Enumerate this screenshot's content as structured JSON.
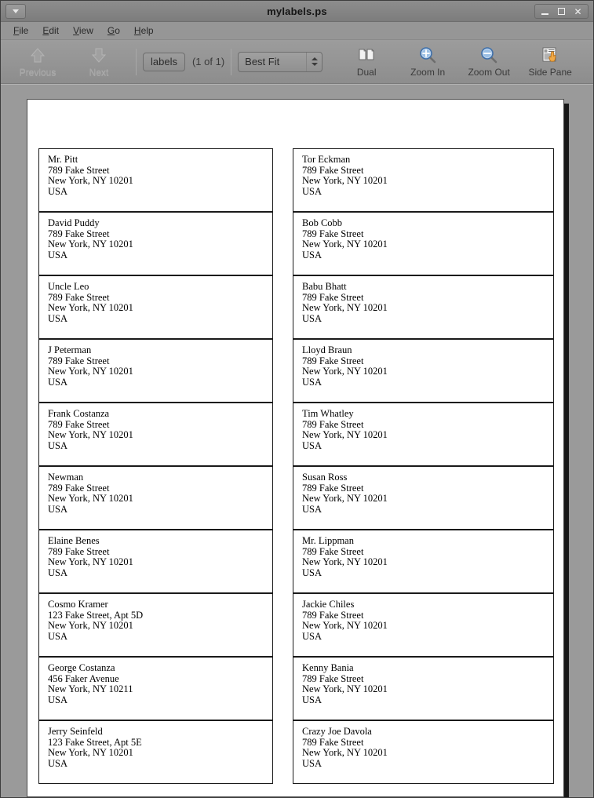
{
  "window": {
    "title": "mylabels.ps",
    "menu_button_icon": "chevron-down-icon",
    "minimize_label": "Minimize",
    "maximize_label": "Maximize",
    "close_label": "✕"
  },
  "menubar": {
    "items": [
      {
        "label": "File",
        "mnemonic": "F",
        "rest": "ile"
      },
      {
        "label": "Edit",
        "mnemonic": "E",
        "rest": "dit"
      },
      {
        "label": "View",
        "mnemonic": "V",
        "rest": "iew"
      },
      {
        "label": "Go",
        "mnemonic": "G",
        "rest": "o"
      },
      {
        "label": "Help",
        "mnemonic": "H",
        "rest": "elp"
      }
    ]
  },
  "toolbar": {
    "previous_label": "Previous",
    "previous_icon": "arrow-up-icon",
    "previous_enabled": false,
    "next_label": "Next",
    "next_icon": "arrow-down-icon",
    "next_enabled": false,
    "page_label": "labels",
    "page_count": "(1 of 1)",
    "zoom_value": "Best Fit",
    "dual_label": "Dual",
    "dual_icon": "dual-page-icon",
    "zoom_in_label": "Zoom In",
    "zoom_in_icon": "magnifier-plus-icon",
    "zoom_out_label": "Zoom Out",
    "zoom_out_icon": "magnifier-minus-icon",
    "side_pane_label": "Side Pane",
    "side_pane_icon": "side-pane-icon"
  },
  "document": {
    "labels": [
      {
        "name": "Mr. Pitt",
        "street": "789 Fake Street",
        "city": "New York, NY 10201",
        "country": "USA"
      },
      {
        "name": "Tor Eckman",
        "street": "789 Fake Street",
        "city": "New York, NY 10201",
        "country": "USA"
      },
      {
        "name": "David Puddy",
        "street": "789 Fake Street",
        "city": "New York, NY 10201",
        "country": "USA"
      },
      {
        "name": "Bob Cobb",
        "street": "789 Fake Street",
        "city": "New York, NY 10201",
        "country": "USA"
      },
      {
        "name": "Uncle Leo",
        "street": "789 Fake Street",
        "city": "New York, NY 10201",
        "country": "USA"
      },
      {
        "name": "Babu Bhatt",
        "street": "789 Fake Street",
        "city": "New York, NY 10201",
        "country": "USA"
      },
      {
        "name": "J Peterman",
        "street": "789 Fake Street",
        "city": "New York, NY 10201",
        "country": "USA"
      },
      {
        "name": "Lloyd Braun",
        "street": "789 Fake Street",
        "city": "New York, NY 10201",
        "country": "USA"
      },
      {
        "name": "Frank Costanza",
        "street": "789 Fake Street",
        "city": "New York, NY 10201",
        "country": "USA"
      },
      {
        "name": "Tim Whatley",
        "street": "789 Fake Street",
        "city": "New York, NY 10201",
        "country": "USA"
      },
      {
        "name": "Newman",
        "street": "789 Fake Street",
        "city": "New York, NY 10201",
        "country": "USA"
      },
      {
        "name": "Susan Ross",
        "street": "789 Fake Street",
        "city": "New York, NY 10201",
        "country": "USA"
      },
      {
        "name": "Elaine Benes",
        "street": "789 Fake Street",
        "city": "New York, NY 10201",
        "country": "USA"
      },
      {
        "name": "Mr. Lippman",
        "street": "789 Fake Street",
        "city": "New York, NY 10201",
        "country": "USA"
      },
      {
        "name": "Cosmo Kramer",
        "street": "123 Fake Street, Apt 5D",
        "city": "New York, NY 10201",
        "country": "USA"
      },
      {
        "name": "Jackie Chiles",
        "street": "789 Fake Street",
        "city": "New York, NY 10201",
        "country": "USA"
      },
      {
        "name": "George Costanza",
        "street": "456 Faker Avenue",
        "city": "New York, NY 10211",
        "country": "USA"
      },
      {
        "name": "Kenny Bania",
        "street": "789 Fake Street",
        "city": "New York, NY 10201",
        "country": "USA"
      },
      {
        "name": "Jerry Seinfeld",
        "street": "123 Fake Street, Apt 5E",
        "city": "New York, NY 10201",
        "country": "USA"
      },
      {
        "name": "Crazy Joe Davola",
        "street": "789 Fake Street",
        "city": "New York, NY 10201",
        "country": "USA"
      }
    ]
  },
  "colors": {
    "chrome": "#969696",
    "titlebar": "#858585",
    "page": "#ffffff",
    "label_border": "#1a1a1a",
    "accent_blue": "#5b8fc9",
    "accent_orange": "#e8a33d"
  }
}
